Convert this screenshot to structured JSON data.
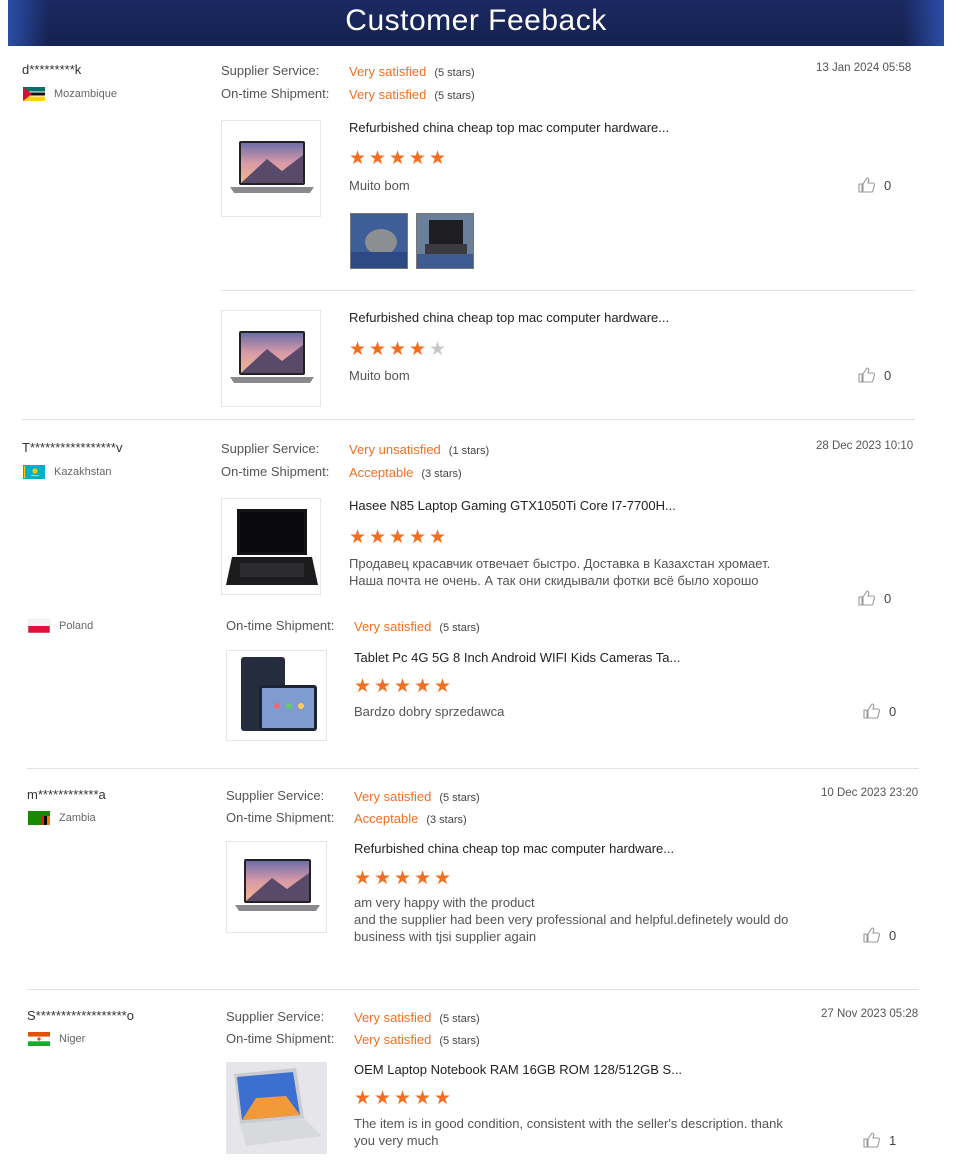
{
  "header": {
    "title": "Customer Feeback"
  },
  "labels": {
    "supplier_service": "Supplier Service:",
    "ontime_shipment": "On-time Shipment:"
  },
  "reviews": [
    {
      "user": "d*********k",
      "country": "Mozambique",
      "date": "13 Jan 2024 05:58",
      "supplier": {
        "value": "Very satisfied",
        "stars": "(5 stars)"
      },
      "shipment": {
        "value": "Very satisfied",
        "stars": "(5 stars)"
      },
      "items": [
        {
          "title": "Refurbished china cheap top mac computer hardware...",
          "rating": 5,
          "comment": "Muito bom",
          "likes": "0",
          "photos": 2
        },
        {
          "title": "Refurbished china cheap top mac computer hardware...",
          "rating": 4,
          "comment": "Muito bom",
          "likes": "0"
        }
      ]
    },
    {
      "user": "T*****************v",
      "country": "Kazakhstan",
      "date": "28 Dec 2023 10:10",
      "supplier": {
        "value": "Very unsatisfied",
        "stars": "(1 stars)"
      },
      "shipment": {
        "value": "Acceptable",
        "stars": "(3 stars)"
      },
      "items": [
        {
          "title": "Hasee N85 Laptop Gaming GTX1050Ti Core I7-7700H...",
          "rating": 5,
          "comment": "Продавец красавчик отвечает быстро. Доставка в Казахстан хромает. Наша почта не очень. А так они скидывали фотки всё было хорошо",
          "likes": "0"
        }
      ]
    },
    {
      "user": "",
      "country": "Poland",
      "date": "",
      "shipment": {
        "value": "Very satisfied",
        "stars": "(5 stars)"
      },
      "items": [
        {
          "title": "Tablet Pc 4G 5G 8 Inch Android WIFI Kids Cameras Ta...",
          "rating": 5,
          "comment": "Bardzo dobry sprzedawca",
          "likes": "0"
        }
      ]
    },
    {
      "user": "m************a",
      "country": "Zambia",
      "date": "10 Dec 2023 23:20",
      "supplier": {
        "value": "Very satisfied",
        "stars": "(5 stars)"
      },
      "shipment": {
        "value": "Acceptable",
        "stars": "(3 stars)"
      },
      "items": [
        {
          "title": "Refurbished china cheap top mac computer hardware...",
          "rating": 5,
          "comment": "am very happy with the product\nand the supplier had been very professional and helpful.definetely would do business with tjsi supplier again",
          "likes": "0"
        }
      ]
    },
    {
      "user": "S******************o",
      "country": "Niger",
      "date": "27 Nov 2023 05:28",
      "supplier": {
        "value": "Very satisfied",
        "stars": "(5 stars)"
      },
      "shipment": {
        "value": "Very satisfied",
        "stars": "(5 stars)"
      },
      "items": [
        {
          "title": "OEM Laptop Notebook RAM 16GB ROM 128/512GB S...",
          "rating": 5,
          "comment": "The item is in good condition, consistent with the seller's description. thank you very much",
          "likes": "1"
        }
      ]
    }
  ]
}
